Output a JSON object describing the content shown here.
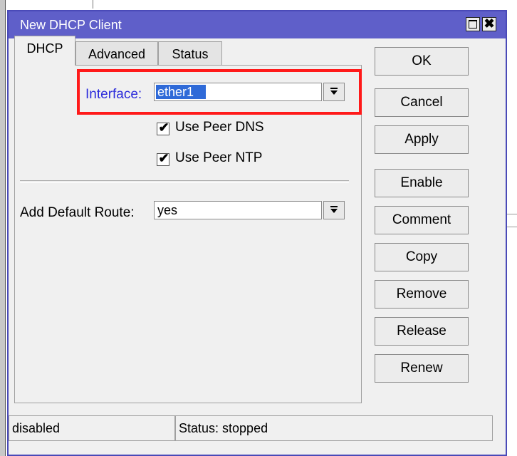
{
  "window": {
    "title": "New DHCP Client",
    "maximize_glyph": "",
    "close_glyph": "✖"
  },
  "tabs": [
    {
      "label": "DHCP",
      "active": true
    },
    {
      "label": "Advanced",
      "active": false
    },
    {
      "label": "Status",
      "active": false
    }
  ],
  "form": {
    "interface_label": "Interface:",
    "interface_value": "ether1",
    "use_peer_dns_label": "Use Peer DNS",
    "use_peer_dns_checked": true,
    "use_peer_ntp_label": "Use Peer NTP",
    "use_peer_ntp_checked": true,
    "add_default_route_label": "Add Default Route:",
    "add_default_route_value": "yes"
  },
  "buttons": {
    "ok": "OK",
    "cancel": "Cancel",
    "apply": "Apply",
    "enable": "Enable",
    "comment": "Comment",
    "copy": "Copy",
    "remove": "Remove",
    "release": "Release",
    "renew": "Renew"
  },
  "statusbar": {
    "left": "disabled",
    "right": "Status: stopped"
  },
  "colors": {
    "titlebar": "#5f5fc9",
    "interface_label": "#2b2bdb",
    "highlight_box": "#ff1a1a",
    "selection": "#2f6ad8"
  }
}
